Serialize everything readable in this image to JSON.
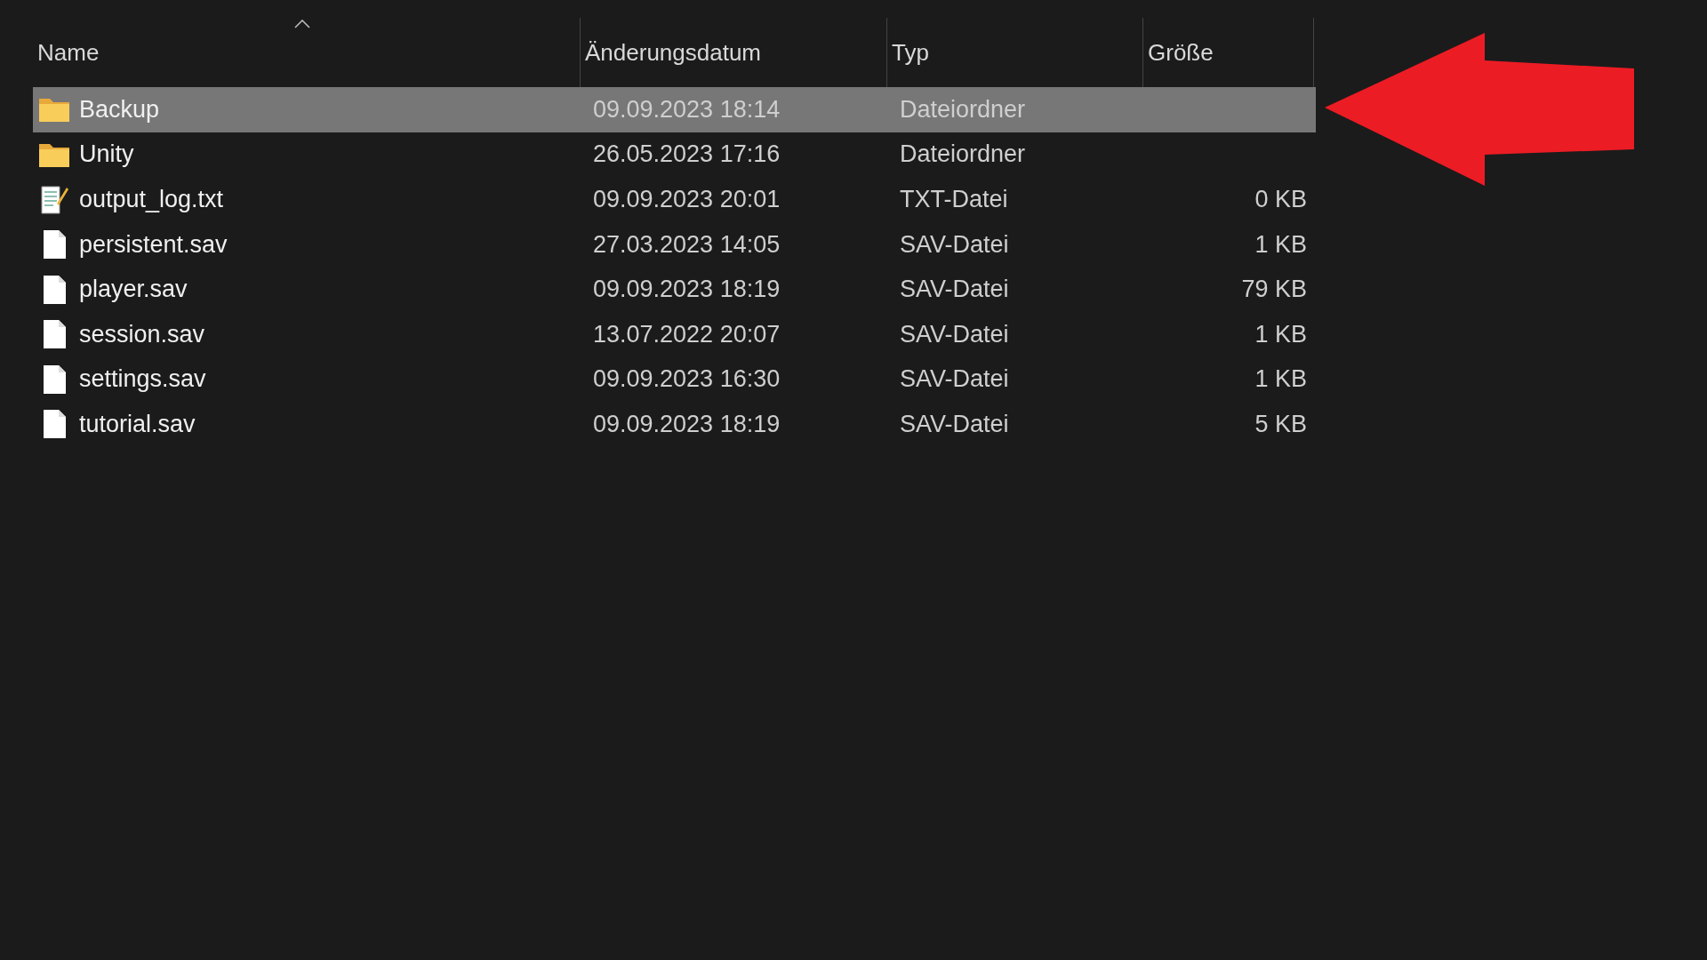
{
  "columns": [
    {
      "label": "Name",
      "sorted": true
    },
    {
      "label": "Änderungsdatum",
      "sorted": false
    },
    {
      "label": "Typ",
      "sorted": false
    },
    {
      "label": "Größe",
      "sorted": false
    }
  ],
  "files": [
    {
      "name": "Backup",
      "modified": "09.09.2023 18:14",
      "type": "Dateiordner",
      "kind": "folder",
      "selected": true
    },
    {
      "name": "Unity",
      "modified": "26.05.2023 17:16",
      "type": "Dateiordner",
      "kind": "folder",
      "selected": false
    },
    {
      "name": "output_log.txt",
      "modified": "09.09.2023 20:01",
      "type": "TXT-Datei",
      "size": "0 KB",
      "kind": "text",
      "selected": false
    },
    {
      "name": "persistent.sav",
      "modified": "27.03.2023 14:05",
      "type": "SAV-Datei",
      "size": "1 KB",
      "kind": "file",
      "selected": false
    },
    {
      "name": "player.sav",
      "modified": "09.09.2023 18:19",
      "type": "SAV-Datei",
      "size": "79 KB",
      "kind": "file",
      "selected": false
    },
    {
      "name": "session.sav",
      "modified": "13.07.2022 20:07",
      "type": "SAV-Datei",
      "size": "1 KB",
      "kind": "file",
      "selected": false
    },
    {
      "name": "settings.sav",
      "modified": "09.09.2023 16:30",
      "type": "SAV-Datei",
      "size": "1 KB",
      "kind": "file",
      "selected": false
    },
    {
      "name": "tutorial.sav",
      "modified": "09.09.2023 18:19",
      "type": "SAV-Datei",
      "size": "5 KB",
      "kind": "file",
      "selected": false
    }
  ]
}
